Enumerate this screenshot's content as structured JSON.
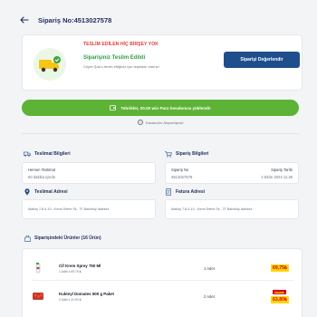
{
  "header": {
    "title": "Sipariş No:4513027578"
  },
  "status": {
    "warning": "TESLİM EDİLEN HİÇ BİRŞEY YOK",
    "title": "Siparişiniz Teslim Edildi",
    "subtitle": "Cepte Şok'u tercih ettiğiniz için teşekkür ederiz!",
    "evaluate_button": "Siparişi Değerlendir"
  },
  "banner": {
    "text": "Tebrikler, 20.00 win Para hesabınıza yüklendi!",
    "link": "Kazandırır Alışverişiniz!"
  },
  "delivery_info": {
    "title": "Teslimat Bilgileri",
    "label": "Hemen Teslimat",
    "value": "60 dakika içinde"
  },
  "order_info": {
    "title": "Sipariş Bilgileri",
    "no_label": "Sipariş No",
    "no_value": "4513027578",
    "date_label": "Sipariş Tarihi",
    "date_value": "2 Ekim 2024 11:26"
  },
  "delivery_address": {
    "title": "Teslimat Adresi",
    "text": "Ataköy 7-8-9-10.. Kısım Defne Sk.. 7F Bakırköy İstanbul"
  },
  "invoice_address": {
    "title": "Fatura Adresi",
    "text": "Ataköy 7-8-9-10.. Kısım Defne Sk.. 7F Bakırköy İstanbul"
  },
  "products": {
    "title": "Siparişindeki Ürünler (16 Ürün)",
    "items": [
      {
        "name": "Cif Krem Sprey 750 Ml",
        "meta": "1 Adet x 69.75 ₺",
        "qty": "1 Adet",
        "price": "69,75₺",
        "old_price": ""
      },
      {
        "name": "Kukteyl Domates 500 g Paket",
        "meta": "2 Adet x 31.90 ₺",
        "qty": "2 Adet",
        "price": "63,80₺",
        "old_price": "79,00₺"
      }
    ]
  },
  "colors": {
    "green": "#5cb335",
    "navy": "#1f4e8c",
    "red": "#e53935",
    "price_yellow": "#ffd400"
  }
}
